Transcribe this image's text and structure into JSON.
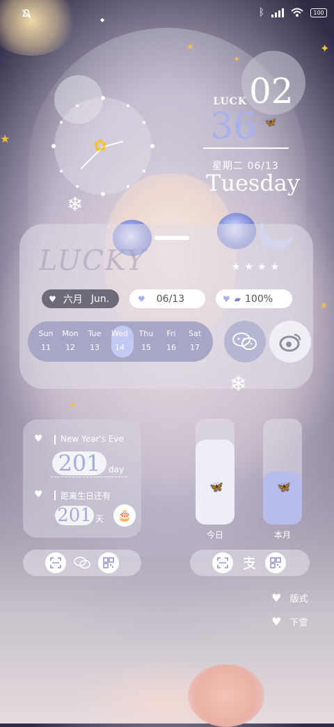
{
  "status_bar": {
    "battery": "100"
  },
  "date_widget": {
    "luck_label": "LUCK",
    "day": "02",
    "number": "36",
    "week_and_date": "星期二  06/13",
    "weekday": "Tuesday"
  },
  "card": {
    "watermark": "LUCKY",
    "month_pill": {
      "cn": "六月",
      "en": "Jun."
    },
    "date_pill": "06/13",
    "battery_pill": "100%",
    "week_days": [
      {
        "name": "Sun",
        "num": "11"
      },
      {
        "name": "Mon",
        "num": "12"
      },
      {
        "name": "Tue",
        "num": "13"
      },
      {
        "name": "Wed",
        "num": "14"
      },
      {
        "name": "Thu",
        "num": "15"
      },
      {
        "name": "Fri",
        "num": "16"
      },
      {
        "name": "Sat",
        "num": "17"
      }
    ],
    "selected_day": "Tue",
    "apps": [
      "wechat-icon",
      "weibo-icon"
    ]
  },
  "countdown": {
    "event1_title": "New Year's Eve",
    "event1_value": "201",
    "event1_unit": "day",
    "event2_title": "距离生日还有",
    "event2_value": "201",
    "event2_unit": "天"
  },
  "progress": {
    "today_label": "今日",
    "today_fraction": 0.8,
    "month_label": "本月",
    "month_fraction": 0.5
  },
  "dock_left": [
    "scan-icon",
    "wechat-icon",
    "qr-code-icon"
  ],
  "dock_right": [
    "scan-icon",
    "alipay-icon",
    "qr-code-icon"
  ],
  "menu": {
    "item1": "版式",
    "item2": "下雪"
  },
  "colors": {
    "accent": "#a9b0ee",
    "week_bar": "#a6a7c6",
    "selected_day": "#c4c9f3",
    "pill_dark": "#6f6a78"
  }
}
